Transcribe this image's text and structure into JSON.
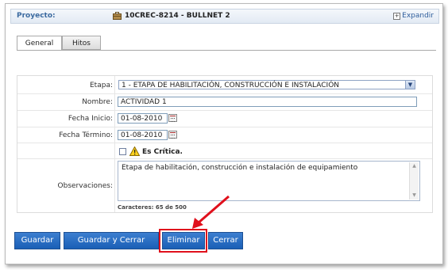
{
  "header": {
    "project_label": "Proyecto:",
    "project_name": "10CREC-8214 - BULLNET 2",
    "expand_label": "Expandir"
  },
  "tabs": [
    {
      "label": "General",
      "active": true
    },
    {
      "label": "Hitos",
      "active": false
    }
  ],
  "form": {
    "etapa": {
      "label": "Etapa:",
      "value": "1 - ETAPA DE HABILITACIÓN, CONSTRUCCIÓN E INSTALACIÓN"
    },
    "nombre": {
      "label": "Nombre:",
      "value": "ACTIVIDAD 1"
    },
    "fecha_inicio": {
      "label": "Fecha Inicio:",
      "value": "01-08-2010"
    },
    "fecha_termino": {
      "label": "Fecha Término:",
      "value": "01-08-2010"
    },
    "critica": {
      "label": "Es Crítica.",
      "checked": false
    },
    "observaciones": {
      "label": "Observaciones:",
      "value": "Etapa de habilitación, construcción e instalación de equipamiento",
      "char_count": "Caracteres: 65 de 500"
    }
  },
  "buttons": {
    "guardar": "Guardar",
    "guardar_cerrar": "Guardar y Cerrar",
    "eliminar": "Eliminar",
    "cerrar": "Cerrar"
  },
  "colors": {
    "button_blue": "#1a5fb6",
    "highlight_red": "#e0101c",
    "header_label_blue": "#3b6aa0"
  }
}
